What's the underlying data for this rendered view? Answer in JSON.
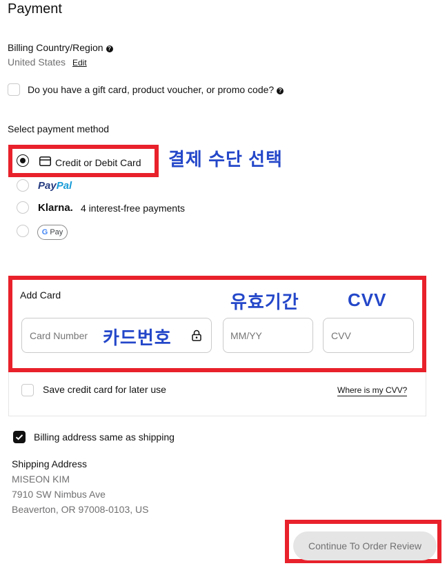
{
  "page": {
    "title": "Payment"
  },
  "billing": {
    "heading": "Billing Country/Region",
    "country": "United States",
    "edit_label": "Edit"
  },
  "gift_card": {
    "label": "Do you have a gift card, product voucher, or promo code?",
    "checked": false
  },
  "payment_method": {
    "heading": "Select payment method",
    "options": [
      {
        "id": "card",
        "label": "Credit or Debit Card",
        "selected": true
      },
      {
        "id": "paypal",
        "pay": "Pay",
        "pal": "Pal",
        "selected": false
      },
      {
        "id": "klarna",
        "brand": "Klarna.",
        "label": "4 interest-free payments",
        "selected": false
      },
      {
        "id": "gpay",
        "g": "G",
        "pay": "Pay",
        "selected": false
      }
    ]
  },
  "annotations": {
    "payment_method": "결제 수단 선택",
    "expiry": "유효기간",
    "cvv": "CVV",
    "card_number": "카드번호"
  },
  "add_card": {
    "heading": "Add Card",
    "card_number_placeholder": "Card Number",
    "expiry_placeholder": "MM/YY",
    "cvv_placeholder": "CVV"
  },
  "save_card": {
    "label": "Save credit card for later use",
    "checked": false
  },
  "cvv_help_link": "Where is my CVV?",
  "billing_same": {
    "label": "Billing address same as shipping",
    "checked": true
  },
  "shipping": {
    "heading": "Shipping Address",
    "name": "MISEON KIM",
    "street": "7910 SW Nimbus Ave",
    "city_line": "Beaverton, OR 97008-0103, US"
  },
  "continue_button": "Continue To Order Review",
  "colors": {
    "annotation_box": "#e8212b",
    "annotation_text": "#2447c9",
    "paypal_dark": "#253b80",
    "paypal_light": "#179bd7"
  }
}
